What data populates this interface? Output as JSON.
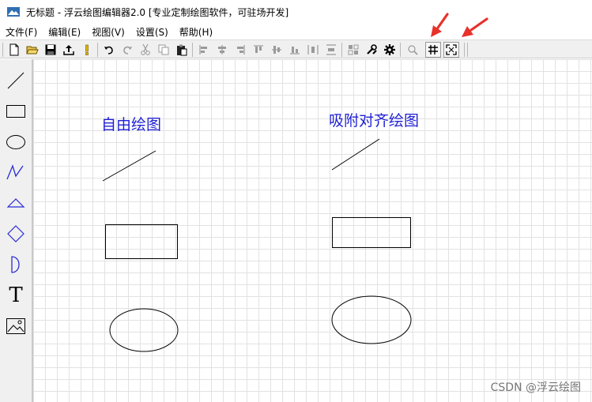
{
  "window": {
    "title": "无标题 - 浮云绘图编辑器2.0 [专业定制绘图软件，可驻场开发]"
  },
  "menu": [
    {
      "label": "文件(F)"
    },
    {
      "label": "编辑(E)"
    },
    {
      "label": "视图(V)"
    },
    {
      "label": "设置(S)"
    },
    {
      "label": "帮助(H)"
    }
  ],
  "toolbar": {
    "buttons": [
      {
        "icon": "new-file-icon"
      },
      {
        "icon": "open-folder-icon"
      },
      {
        "icon": "save-icon"
      },
      {
        "icon": "export-icon"
      },
      {
        "icon": "exclamation-icon"
      },
      {
        "icon": "undo-icon"
      },
      {
        "icon": "redo-icon"
      },
      {
        "icon": "cut-icon"
      },
      {
        "icon": "copy-icon"
      },
      {
        "icon": "paste-icon"
      },
      {
        "icon": "align-left-icon"
      },
      {
        "icon": "align-center-icon"
      },
      {
        "icon": "align-right-icon"
      },
      {
        "icon": "align-top-icon"
      },
      {
        "icon": "align-middle-icon"
      },
      {
        "icon": "align-bottom-icon"
      },
      {
        "icon": "distribute-horizontal-icon"
      },
      {
        "icon": "distribute-vertical-icon"
      },
      {
        "icon": "group-icon"
      },
      {
        "icon": "tools-icon"
      },
      {
        "icon": "gear-icon"
      },
      {
        "icon": "zoom-icon"
      },
      {
        "icon": "grid-icon",
        "pressed": true
      },
      {
        "icon": "snap-icon",
        "pressed": true
      }
    ]
  },
  "sidebar": {
    "tools": [
      {
        "icon": "line-tool-icon"
      },
      {
        "icon": "rectangle-tool-icon"
      },
      {
        "icon": "ellipse-tool-icon"
      },
      {
        "icon": "polyline-tool-icon"
      },
      {
        "icon": "triangle-tool-icon"
      },
      {
        "icon": "diamond-tool-icon"
      },
      {
        "icon": "half-circle-tool-icon"
      },
      {
        "icon": "text-tool-icon",
        "glyph": "T"
      },
      {
        "icon": "image-tool-icon"
      }
    ]
  },
  "canvas": {
    "labels": {
      "free_drawing": "自由绘图",
      "snap_drawing": "吸附对齐绘图"
    },
    "label_color": "#1f1fd6",
    "watermark": "CSDN @浮云绘图"
  },
  "annotation": {
    "arrow_color": "#e8312b"
  }
}
